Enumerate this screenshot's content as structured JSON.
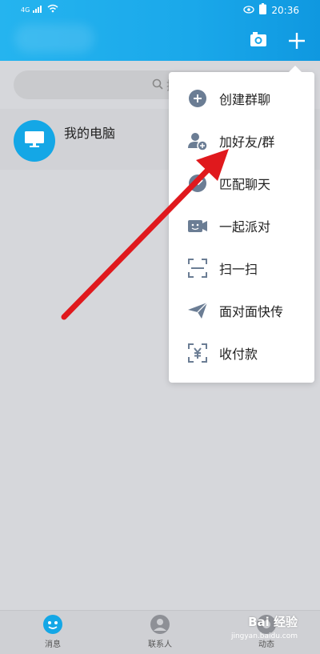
{
  "status_bar": {
    "network": "4G",
    "time": "20:36"
  },
  "search": {
    "placeholder": "搜"
  },
  "conversations": [
    {
      "name": "我的电脑"
    }
  ],
  "menu": {
    "items": [
      {
        "label": "创建群聊",
        "icon": "group-chat-plus-icon"
      },
      {
        "label": "加好友/群",
        "icon": "add-friend-icon"
      },
      {
        "label": "匹配聊天",
        "icon": "match-chat-icon"
      },
      {
        "label": "一起派对",
        "icon": "party-icon"
      },
      {
        "label": "扫一扫",
        "icon": "scan-icon"
      },
      {
        "label": "面对面快传",
        "icon": "send-icon"
      },
      {
        "label": "收付款",
        "icon": "payment-icon"
      }
    ]
  },
  "tabs": [
    {
      "label": "消息",
      "icon": "messages-icon"
    },
    {
      "label": "联系人",
      "icon": "contacts-icon"
    },
    {
      "label": "动态",
      "icon": "moments-icon"
    }
  ],
  "watermark": {
    "text": "Bai 经验",
    "sub": "jingyan.baidu.com"
  },
  "colors": {
    "header": "#1aa8ea",
    "accent": "#14a7e6",
    "arrow": "#e0191d",
    "menu_icon": "#6b7d94"
  }
}
